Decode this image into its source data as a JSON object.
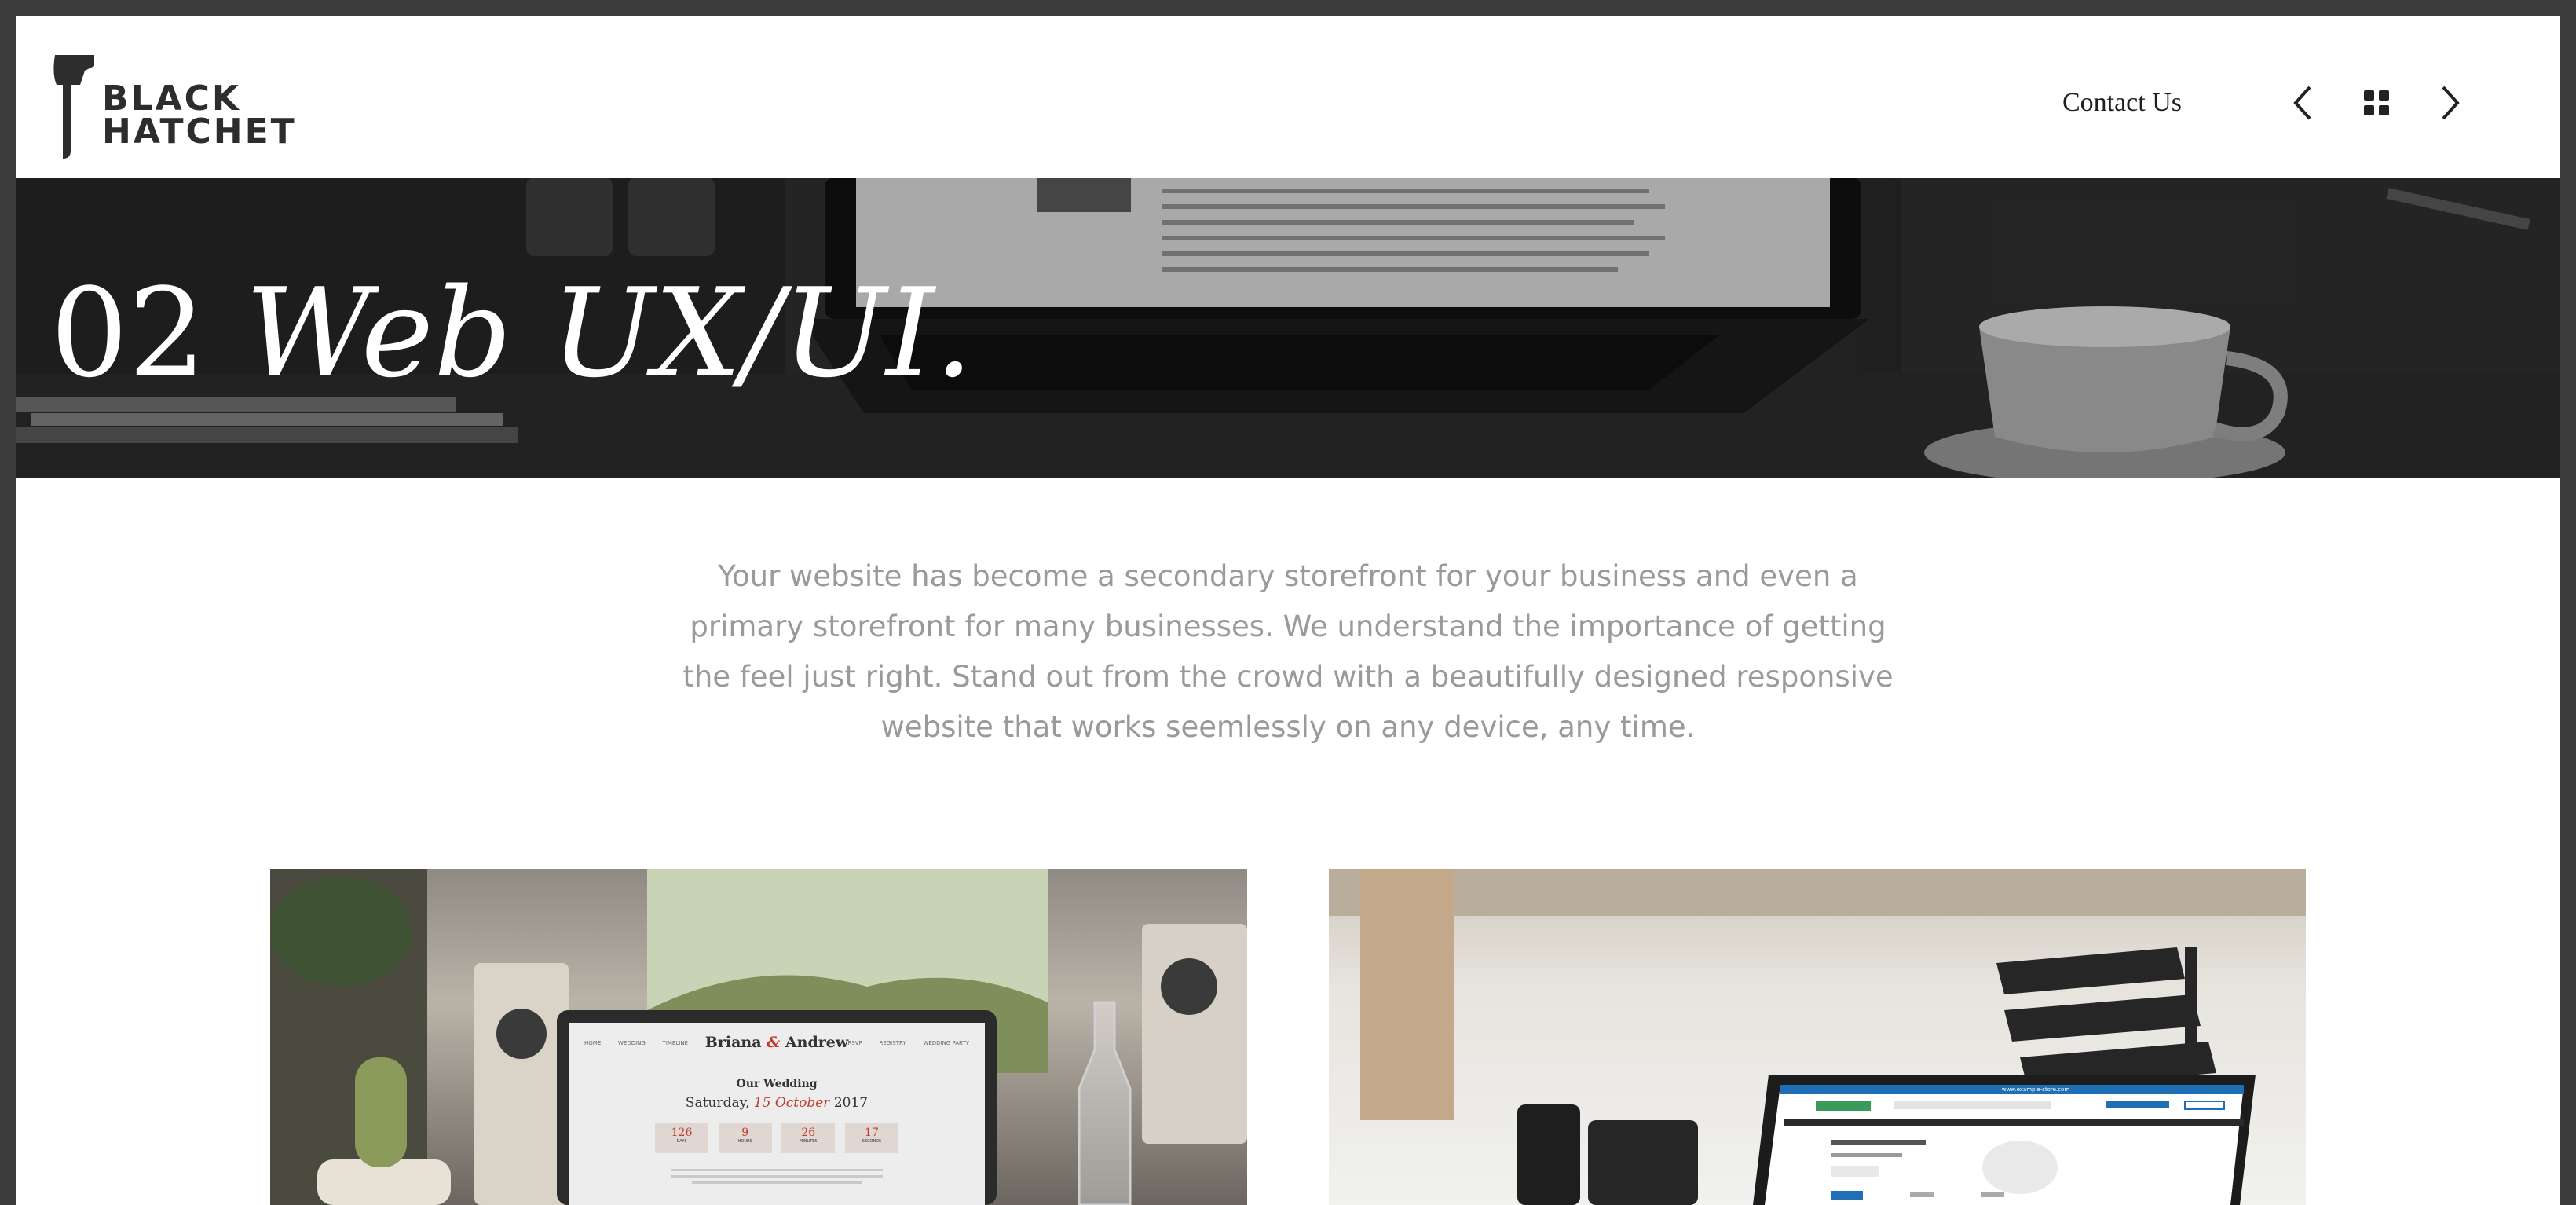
{
  "brand": {
    "logo_line1": "BLACK",
    "logo_line2": "HATCHET",
    "color": "#2d2d2d"
  },
  "nav": {
    "contact_label": "Contact Us",
    "prev_icon": "chevron-left-icon",
    "grid_icon": "grid-icon",
    "next_icon": "chevron-right-icon"
  },
  "hero": {
    "number": "02",
    "title": "Web UX/UI."
  },
  "intro": {
    "text": "Your website has become a secondary storefront for your business and even a primary storefront for many businesses. We understand the importance of getting the feel just right. Stand out from the crowd with a beautifully designed responsive website that works seemlessly on any device, any time."
  },
  "cards": [
    {
      "nav": [
        "HOME",
        "WEDDING",
        "TIMELINE",
        "RSVP",
        "REGISTRY",
        "WEDDING PARTY"
      ],
      "couple_first": "Briana",
      "ampersand": "&",
      "couple_second": "Andrew",
      "heading": "Our Wedding",
      "date_prefix": "Saturday,",
      "date_day_month": "15 October",
      "date_year": "2017",
      "countdown": [
        {
          "value": "126",
          "label": "DAYS"
        },
        {
          "value": "9",
          "label": "HOURS"
        },
        {
          "value": "26",
          "label": "MINUTES"
        },
        {
          "value": "17",
          "label": "SECONDS"
        }
      ]
    },
    {
      "banner": "www.example-store.com"
    }
  ],
  "colors": {
    "page_bg": "#3c3c3c",
    "intro_text": "#9a9a9a",
    "accent_red": "#c0392b",
    "store_blue": "#1e6fb5"
  }
}
